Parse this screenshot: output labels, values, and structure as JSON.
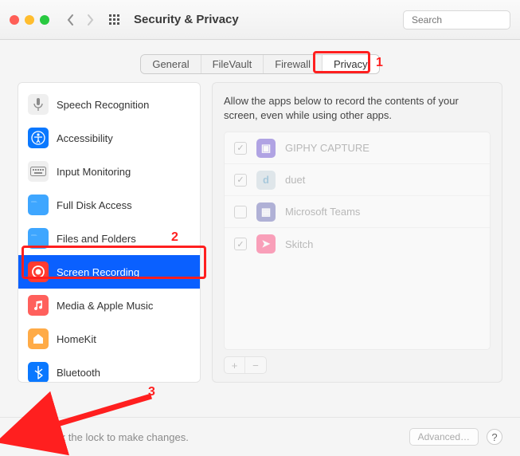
{
  "window": {
    "title": "Security & Privacy"
  },
  "search": {
    "placeholder": "Search"
  },
  "tabs": {
    "general": "General",
    "filevault": "FileVault",
    "firewall": "Firewall",
    "privacy": "Privacy",
    "active_index": 3
  },
  "annotations": {
    "one": "1",
    "two": "2",
    "three": "3"
  },
  "sidebar": {
    "items": [
      {
        "label": "Speech Recognition",
        "icon": "mic"
      },
      {
        "label": "Accessibility",
        "icon": "accessibility"
      },
      {
        "label": "Input Monitoring",
        "icon": "keyboard"
      },
      {
        "label": "Full Disk Access",
        "icon": "disk"
      },
      {
        "label": "Files and Folders",
        "icon": "folder"
      },
      {
        "label": "Screen Recording",
        "icon": "record",
        "selected": true
      },
      {
        "label": "Media & Apple Music",
        "icon": "music"
      },
      {
        "label": "HomeKit",
        "icon": "home"
      },
      {
        "label": "Bluetooth",
        "icon": "bluetooth"
      }
    ]
  },
  "detail": {
    "description": "Allow the apps below to record the contents of your screen, even while using other apps.",
    "apps": [
      {
        "name": "GIPHY CAPTURE",
        "checked": true,
        "iconColor": "#7a63d6",
        "iconText": "▣"
      },
      {
        "name": "duet",
        "checked": true,
        "iconColor": "#c9d7e0",
        "iconText": "d"
      },
      {
        "name": "Microsoft Teams",
        "checked": false,
        "iconColor": "#6a6da9",
        "iconText": "▦"
      },
      {
        "name": "Skitch",
        "checked": true,
        "iconColor": "#ff5b8a",
        "iconText": "➤"
      }
    ]
  },
  "footer": {
    "lock_text": "Click the lock to make changes.",
    "advanced": "Advanced…",
    "help": "?"
  }
}
